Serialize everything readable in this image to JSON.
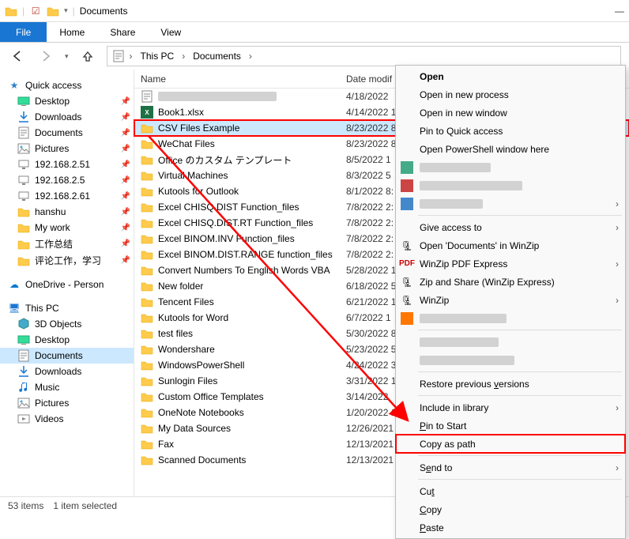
{
  "titlebar": {
    "title": "Documents"
  },
  "ribbon": {
    "file": "File",
    "home": "Home",
    "share": "Share",
    "view": "View"
  },
  "breadcrumb": {
    "root": "This PC",
    "folder": "Documents"
  },
  "sidebar": {
    "quick_access": "Quick access",
    "items": [
      {
        "label": "Desktop",
        "icon": "desktop"
      },
      {
        "label": "Downloads",
        "icon": "downloads"
      },
      {
        "label": "Documents",
        "icon": "documents"
      },
      {
        "label": "Pictures",
        "icon": "pictures"
      },
      {
        "label": "192.168.2.51",
        "icon": "network"
      },
      {
        "label": "192.168.2.5",
        "icon": "network"
      },
      {
        "label": "192.168.2.61",
        "icon": "network"
      },
      {
        "label": "hanshu",
        "icon": "folder"
      },
      {
        "label": "My work",
        "icon": "folder"
      },
      {
        "label": "工作总结",
        "icon": "folder"
      },
      {
        "label": "评论工作，学习",
        "icon": "folder"
      }
    ],
    "onedrive": "OneDrive - Person",
    "thispc": "This PC",
    "thispc_items": [
      {
        "label": "3D Objects"
      },
      {
        "label": "Desktop"
      },
      {
        "label": "Documents"
      },
      {
        "label": "Downloads"
      },
      {
        "label": "Music"
      },
      {
        "label": "Pictures"
      },
      {
        "label": "Videos"
      }
    ]
  },
  "columns": {
    "name": "Name",
    "date": "Date modif"
  },
  "files": [
    {
      "name": "",
      "date": "4/18/2022",
      "icon": "blur"
    },
    {
      "name": "Book1.xlsx",
      "date": "4/14/2022 1",
      "icon": "excel"
    },
    {
      "name": "CSV Files Example",
      "date": "8/23/2022 8",
      "icon": "folder",
      "selected": true
    },
    {
      "name": "WeChat Files",
      "date": "8/23/2022 8",
      "icon": "folder"
    },
    {
      "name": "Office のカスタム テンプレート",
      "date": "8/5/2022 1",
      "icon": "folder"
    },
    {
      "name": "Virtual Machines",
      "date": "8/3/2022 5",
      "icon": "folder"
    },
    {
      "name": "Kutools for Outlook",
      "date": "8/1/2022 8:",
      "icon": "folder"
    },
    {
      "name": "Excel CHISQ.DIST Function_files",
      "date": "7/8/2022 2:",
      "icon": "folder"
    },
    {
      "name": "Excel CHISQ.DIST.RT Function_files",
      "date": "7/8/2022 2:",
      "icon": "folder"
    },
    {
      "name": "Excel BINOM.INV Function_files",
      "date": "7/8/2022 2:",
      "icon": "folder"
    },
    {
      "name": "Excel BINOM.DIST.RANGE function_files",
      "date": "7/8/2022 2:",
      "icon": "folder"
    },
    {
      "name": "Convert Numbers To English Words VBA",
      "date": "5/28/2022 1",
      "icon": "folder"
    },
    {
      "name": "New folder",
      "date": "6/18/2022 5",
      "icon": "folder"
    },
    {
      "name": "Tencent Files",
      "date": "6/21/2022 1",
      "icon": "folder"
    },
    {
      "name": "Kutools for Word",
      "date": "6/7/2022 1",
      "icon": "folder"
    },
    {
      "name": "test files",
      "date": "5/30/2022 8",
      "icon": "folder"
    },
    {
      "name": "Wondershare",
      "date": "5/23/2022 5",
      "icon": "folder"
    },
    {
      "name": "WindowsPowerShell",
      "date": "4/24/2022 3",
      "icon": "folder"
    },
    {
      "name": "Sunlogin Files",
      "date": "3/31/2022 1",
      "icon": "folder"
    },
    {
      "name": "Custom Office Templates",
      "date": "3/14/2022",
      "icon": "folder"
    },
    {
      "name": "OneNote Notebooks",
      "date": "1/20/2022 1",
      "icon": "folder"
    },
    {
      "name": "My Data Sources",
      "date": "12/26/2021",
      "icon": "folder"
    },
    {
      "name": "Fax",
      "date": "12/13/2021",
      "icon": "folder"
    },
    {
      "name": "Scanned Documents",
      "date": "12/13/2021",
      "icon": "folder"
    }
  ],
  "statusbar": {
    "count": "53 items",
    "selected": "1 item selected"
  },
  "ctx": {
    "open": "Open",
    "open_new_process": "Open in new process",
    "open_new_window": "Open in new window",
    "pin_quick": "Pin to Quick access",
    "open_ps": "Open PowerShell window here",
    "give_access": "Give access to",
    "open_winzip": "Open 'Documents' in WinZip",
    "pdf_express": "WinZip PDF Express",
    "zip_share": "Zip and Share (WinZip Express)",
    "winzip": "WinZip",
    "restore": "Restore previous versions",
    "include_lib": "Include in library",
    "pin_start": "Pin to Start",
    "copy_path": "Copy as path",
    "send_to": "Send to",
    "cut": "Cut",
    "copy": "Copy",
    "paste": "Paste"
  }
}
